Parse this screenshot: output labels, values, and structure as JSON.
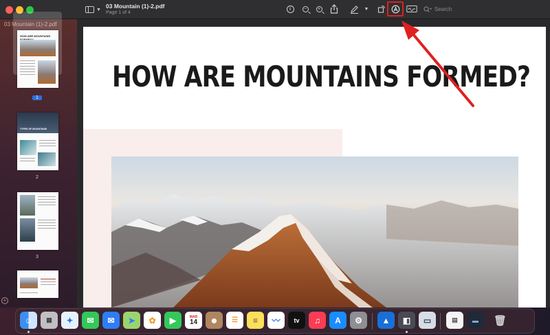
{
  "window": {
    "document_title": "03 Mountain (1)-2.pdf",
    "page_indicator": "Page 1 of 4"
  },
  "toolbar": {
    "search_placeholder": "Search",
    "info_glyph": "i",
    "zoom_out_glyph": "−",
    "zoom_in_glyph": "+",
    "icons": [
      "sidebar-toggle-icon",
      "info-icon",
      "zoom-out-icon",
      "zoom-in-icon",
      "share-icon",
      "markup-pen-icon",
      "rotate-icon",
      "annotate-icon",
      "signature-icon",
      "search-icon"
    ],
    "highlight_color": "#e02020"
  },
  "sidebar": {
    "file_label": "03 Mountain (1)-2.pdf",
    "thumbnails": [
      {
        "page_label": "1",
        "heading": "HOW ARE MOUNTAINS FORMED?"
      },
      {
        "page_label": "2",
        "heading": "TYPES OF MOUNTAINS"
      },
      {
        "page_label": "3",
        "heading": ""
      }
    ]
  },
  "page": {
    "heading": "HOW ARE MOUNTAINS FORMED?"
  },
  "dock": {
    "calendar_month": "MAR",
    "calendar_day": "14",
    "apps": [
      "finder-icon",
      "launchpad-icon",
      "safari-icon",
      "messages-icon",
      "mail-icon",
      "maps-icon",
      "photos-icon",
      "facetime-icon",
      "calendar-icon",
      "contacts-icon",
      "reminders-icon",
      "notes-icon",
      "freeform-icon",
      "tv-icon",
      "music-icon",
      "app-store-icon",
      "system-settings-icon",
      "xcode-icon",
      "preview-icon",
      "screenshot-icon",
      "document-icon",
      "desktop-icon",
      "trash-icon"
    ]
  }
}
